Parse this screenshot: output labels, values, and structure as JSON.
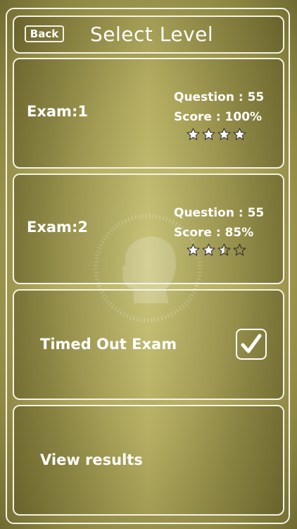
{
  "header": {
    "back_label": "Back",
    "title": "Select Level"
  },
  "exams": [
    {
      "label": "Exam:1",
      "question": "Question : 55",
      "score": "Score : 100%",
      "rating": 4,
      "max_rating": 4
    },
    {
      "label": "Exam:2",
      "question": "Question : 55",
      "score": "Score : 85%",
      "rating": 2.5,
      "max_rating": 4
    }
  ],
  "timed": {
    "label": "Timed Out Exam",
    "checked": true
  },
  "results": {
    "label": "View results"
  },
  "colors": {
    "accent": "#ffffff",
    "background": "#b3ac5f"
  }
}
